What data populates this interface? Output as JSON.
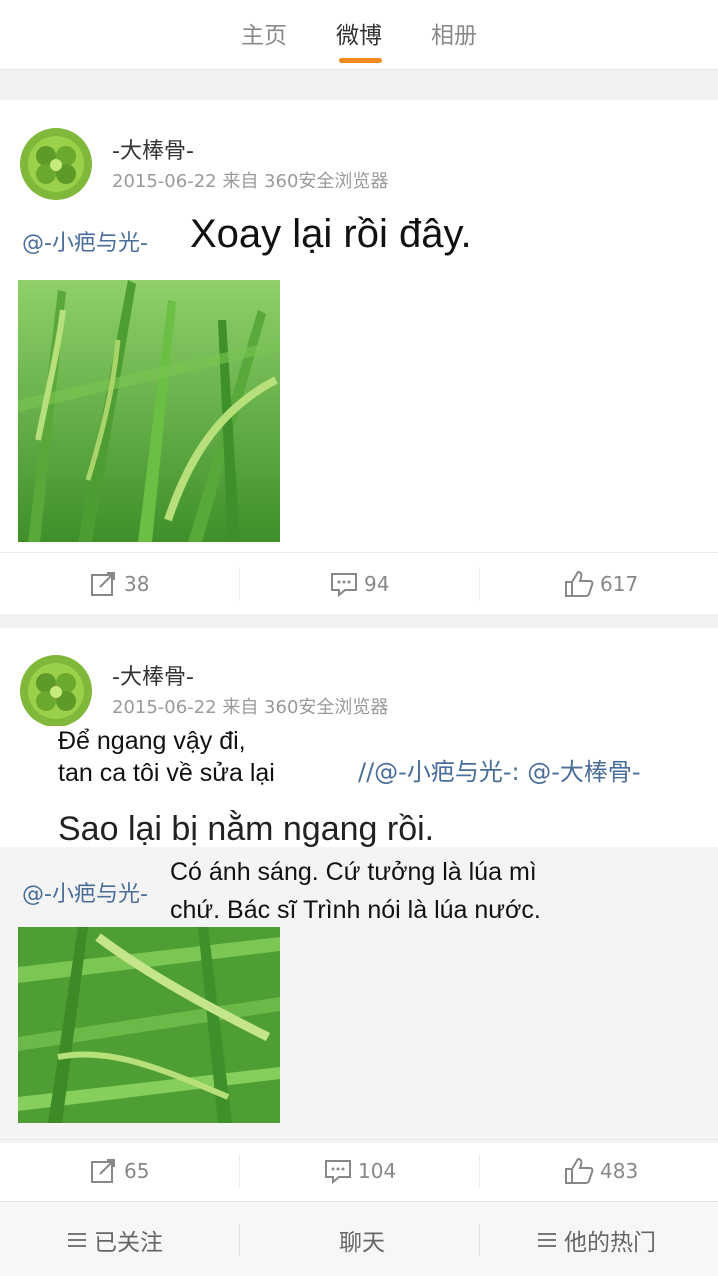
{
  "tabs": [
    {
      "label": "主页",
      "active": false
    },
    {
      "label": "微博",
      "active": true
    },
    {
      "label": "相册",
      "active": false
    }
  ],
  "accent_color": "#f08a1c",
  "link_color": "#4a6d9a",
  "posts": [
    {
      "author": "-大棒骨-",
      "meta": "2015-06-22 来自 360安全浏览器",
      "mention": "@-小疤与光-",
      "overlay_caption": "Xoay lại rồi đây.",
      "image": "rice-plant-photo",
      "actions": {
        "reposts": "38",
        "comments": "94",
        "likes": "617"
      }
    },
    {
      "author": "-大棒骨-",
      "meta": "2015-06-22 来自 360安全浏览器",
      "overlay_text_1_line1": "Để ngang vậy đi,",
      "overlay_text_1_line2": "tan ca tôi về sửa lại",
      "repost_chain": "//@-小疤与光-: @-大棒骨-",
      "overlay_text_2": "Sao lại bị nằm ngang rồi.",
      "mention": "@-小疤与光-",
      "overlay_text_3_line1": "Có ánh sáng. Cứ tưởng là lúa mì",
      "overlay_text_3_line2": "chứ. Bác sĩ Trình nói là lúa nước.",
      "image": "rice-plant-photo",
      "actions": {
        "reposts": "65",
        "comments": "104",
        "likes": "483"
      }
    }
  ],
  "bottom_nav": {
    "following": "已关注",
    "chat": "聊天",
    "hot": "他的热门"
  },
  "icons": [
    "repost-icon",
    "comment-icon",
    "like-icon",
    "menu-icon"
  ]
}
